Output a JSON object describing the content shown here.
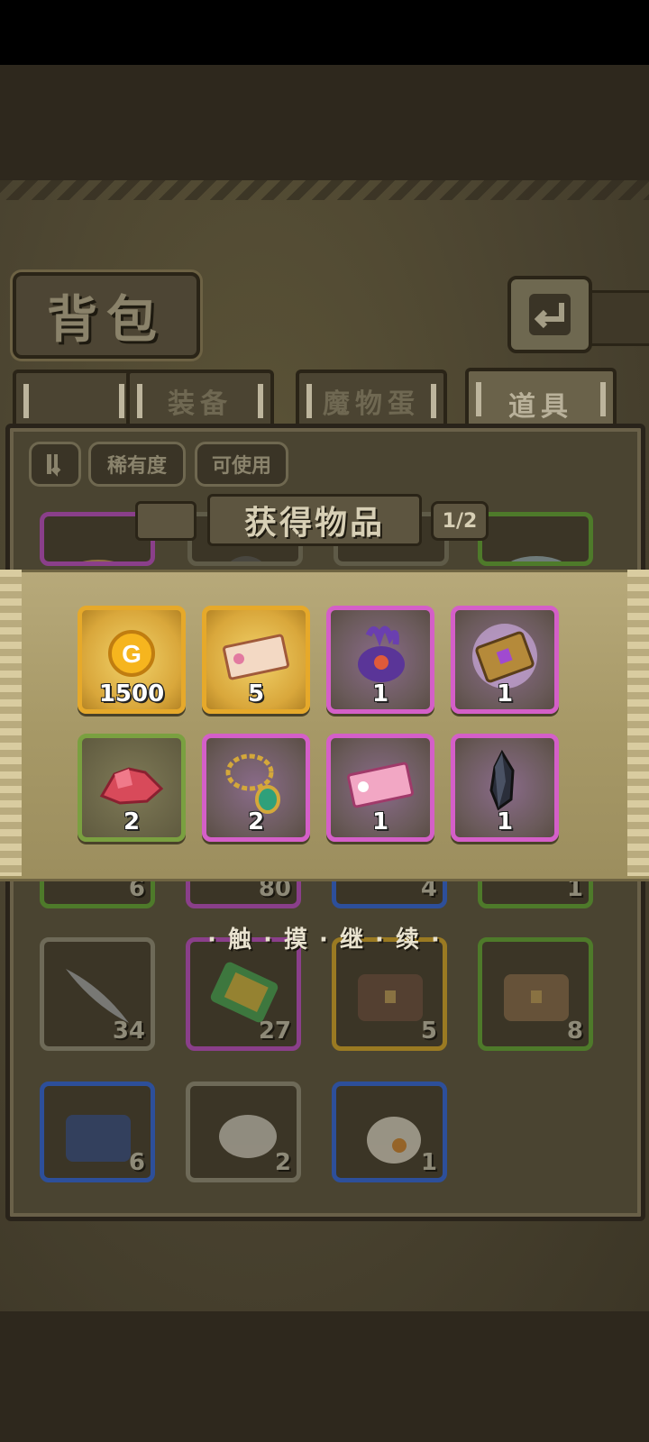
{
  "header": {
    "title": "背包"
  },
  "tabs": [
    {
      "label": "装备"
    },
    {
      "label": "魔物蛋"
    },
    {
      "label": "道具"
    }
  ],
  "filters": {
    "rarity": "稀有度",
    "usable": "可使用"
  },
  "inventory": {
    "row1_counts": [
      "6",
      "80",
      "4",
      "1"
    ],
    "row2_counts": [
      "34",
      "27",
      "5",
      "8"
    ],
    "row3_counts": [
      "6",
      "2",
      "1"
    ]
  },
  "overlay": {
    "title": "获得物品",
    "page": "1/2",
    "rewards": [
      {
        "icon": "gold-coin-icon",
        "count": "1500"
      },
      {
        "icon": "ticket-icon",
        "count": "5"
      },
      {
        "icon": "purple-monster-icon",
        "count": "1"
      },
      {
        "icon": "spell-book-icon",
        "count": "1"
      },
      {
        "icon": "red-crystal-icon",
        "count": "2"
      },
      {
        "icon": "necklace-icon",
        "count": "2"
      },
      {
        "icon": "pink-ticket-icon",
        "count": "1"
      },
      {
        "icon": "dark-crystal-icon",
        "count": "1"
      }
    ],
    "continue_hint": "· 触 · 摸 · 继 · 续 ·"
  },
  "coin_letter": "G"
}
